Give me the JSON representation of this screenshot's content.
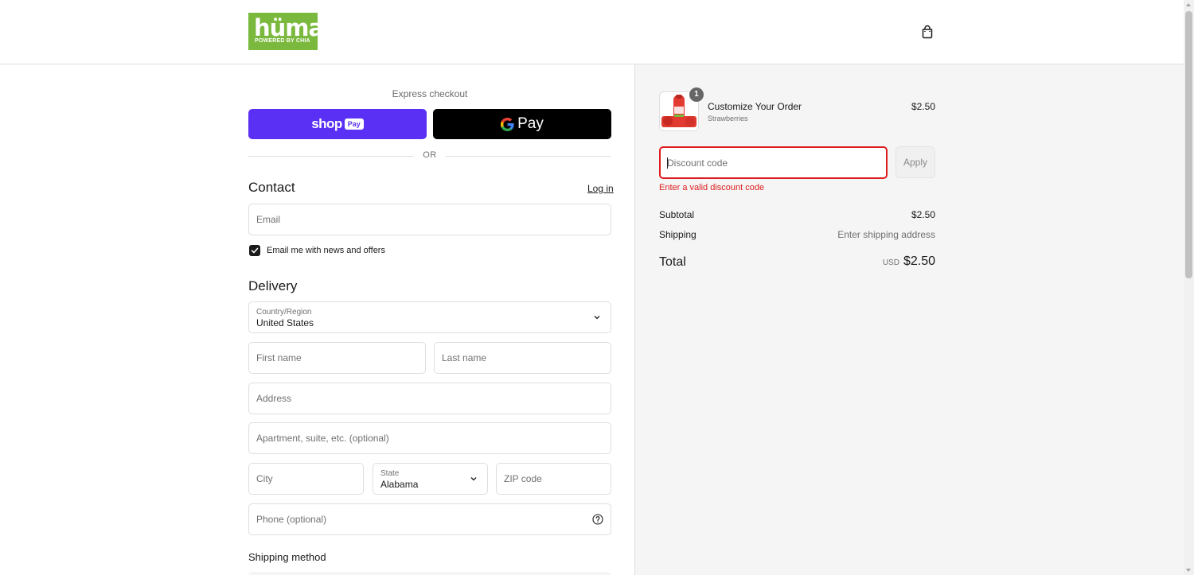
{
  "header": {
    "logo_word": "hüma",
    "logo_sub": "POWERED BY CHIA",
    "cart_icon": "shopping-bag-icon"
  },
  "express": {
    "label": "Express checkout",
    "shoppay_word": "shop",
    "shoppay_pill": "Pay",
    "gpay_word": "Pay",
    "or_text": "OR",
    "shoppay_color": "#5a31f4"
  },
  "contact": {
    "title": "Contact",
    "login_link": "Log in",
    "email_placeholder": "Email",
    "newsletter_label": "Email me with news and offers",
    "newsletter_checked": true
  },
  "delivery": {
    "title": "Delivery",
    "country_label": "Country/Region",
    "country_value": "United States",
    "first_name_placeholder": "First name",
    "last_name_placeholder": "Last name",
    "address_placeholder": "Address",
    "apartment_placeholder": "Apartment, suite, etc. (optional)",
    "city_placeholder": "City",
    "state_label": "State",
    "state_value": "Alabama",
    "zip_placeholder": "ZIP code",
    "phone_placeholder": "Phone (optional)"
  },
  "shipping_method": {
    "title": "Shipping method"
  },
  "summary": {
    "item": {
      "quantity": "1",
      "name": "Customize Your Order",
      "variant": "Strawberries",
      "price": "$2.50"
    },
    "discount": {
      "placeholder": "Discount code",
      "apply_label": "Apply",
      "error": "Enter a valid discount code",
      "error_color": "#dd1d1d"
    },
    "subtotal_label": "Subtotal",
    "subtotal_value": "$2.50",
    "shipping_label": "Shipping",
    "shipping_value": "Enter shipping address",
    "total_label": "Total",
    "total_currency": "USD",
    "total_value": "$2.50"
  }
}
